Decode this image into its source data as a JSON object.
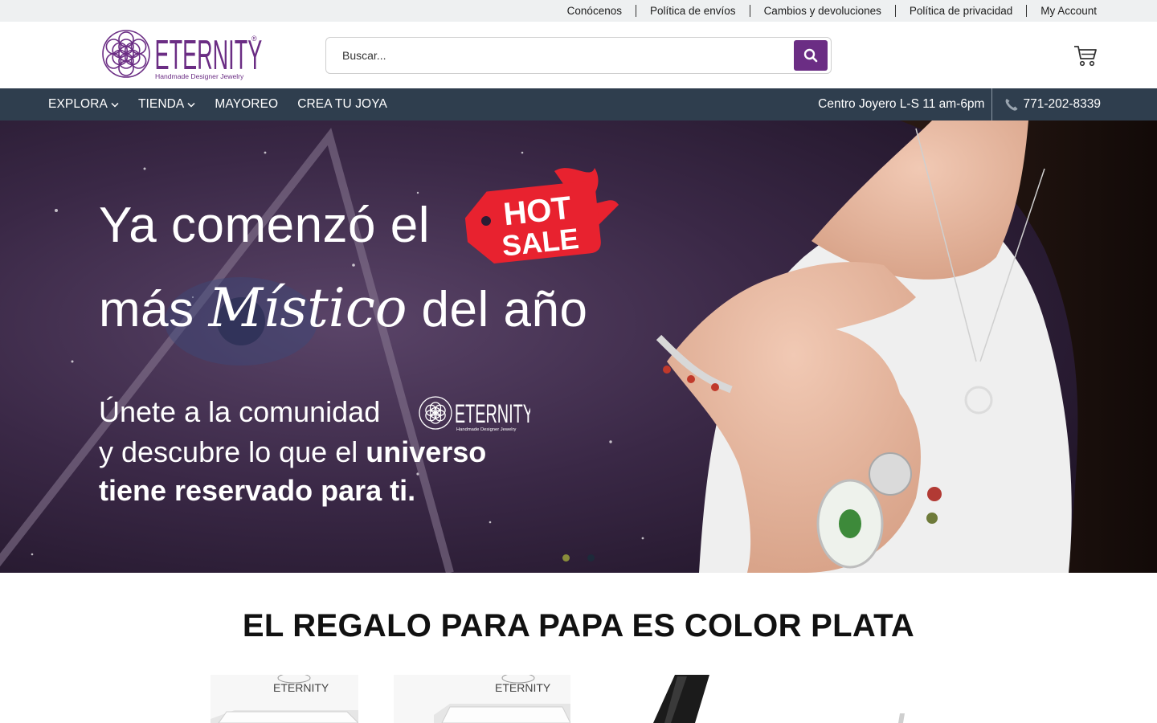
{
  "topbar": {
    "links": [
      "Conócenos",
      "Política de envíos",
      "Cambios y devoluciones",
      "Política de privacidad",
      "My Account"
    ]
  },
  "header": {
    "logo_text": "ETERNITY",
    "logo_tagline": "Handmade Designer Jewelry",
    "search_placeholder": "Buscar...",
    "icons": [
      "search-icon",
      "cart-icon"
    ]
  },
  "nav": {
    "items": [
      {
        "label": "EXPLORA",
        "has_dropdown": true
      },
      {
        "label": "TIENDA",
        "has_dropdown": true
      },
      {
        "label": "MAYOREO",
        "has_dropdown": false
      },
      {
        "label": "CREA TU JOYA",
        "has_dropdown": false
      }
    ],
    "hours": "Centro Joyero L-S 11 am-6pm",
    "phone": "771-202-8339"
  },
  "hero": {
    "line1": "Ya comenzó el",
    "line2_a": "más",
    "line2_script": "Místico",
    "line2_b": "del año",
    "badge_top": "HOT",
    "badge_bottom": "SALE",
    "line3": "Únete a la comunidad",
    "line4_a": "y descubre lo que el",
    "line4_b": "universo",
    "line5": "tiene reservado para ti.",
    "slides_total": 2,
    "active_slide": 1
  },
  "section": {
    "title": "EL REGALO PARA PAPA ES COLOR PLATA",
    "product_box_brand": "ETERNITY"
  },
  "colors": {
    "brand_purple": "#6b2d84",
    "nav_bg": "#2f3e4e",
    "topbar_bg": "#eef0f1",
    "badge_red": "#e8222f"
  }
}
